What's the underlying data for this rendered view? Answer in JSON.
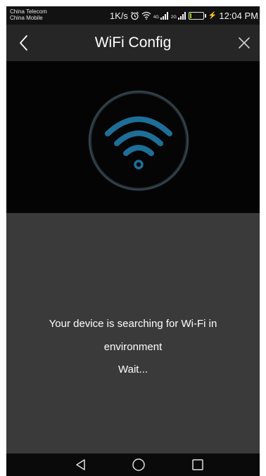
{
  "status_bar": {
    "carrier_1": "China Telecom",
    "carrier_2": "China Mobile",
    "net_speed": "1K/s",
    "network_1": "4G",
    "network_2": "2G",
    "battery": "20",
    "time": "12:04 PM",
    "icons": [
      "alarm-icon",
      "wifi-icon",
      "signal-icon",
      "battery-icon",
      "charging-icon"
    ]
  },
  "nav": {
    "title": "WiFi Config",
    "back_icon": "chevron-left-icon",
    "close_icon": "close-icon"
  },
  "hero": {
    "icon": "wifi-icon"
  },
  "message": {
    "line1": "Your device is searching for Wi-Fi in",
    "line2": "environment",
    "wait": "Wait..."
  },
  "system_nav": {
    "icons": [
      "back-triangle-icon",
      "home-circle-icon",
      "recents-square-icon"
    ]
  },
  "colors": {
    "accent": "#1d6f98",
    "status_bar_bg": "#121212",
    "nav_bar_bg": "#262626",
    "hero_bg": "#040404",
    "content_bg": "#3a3a3a",
    "battery_fill": "#8fd400"
  }
}
